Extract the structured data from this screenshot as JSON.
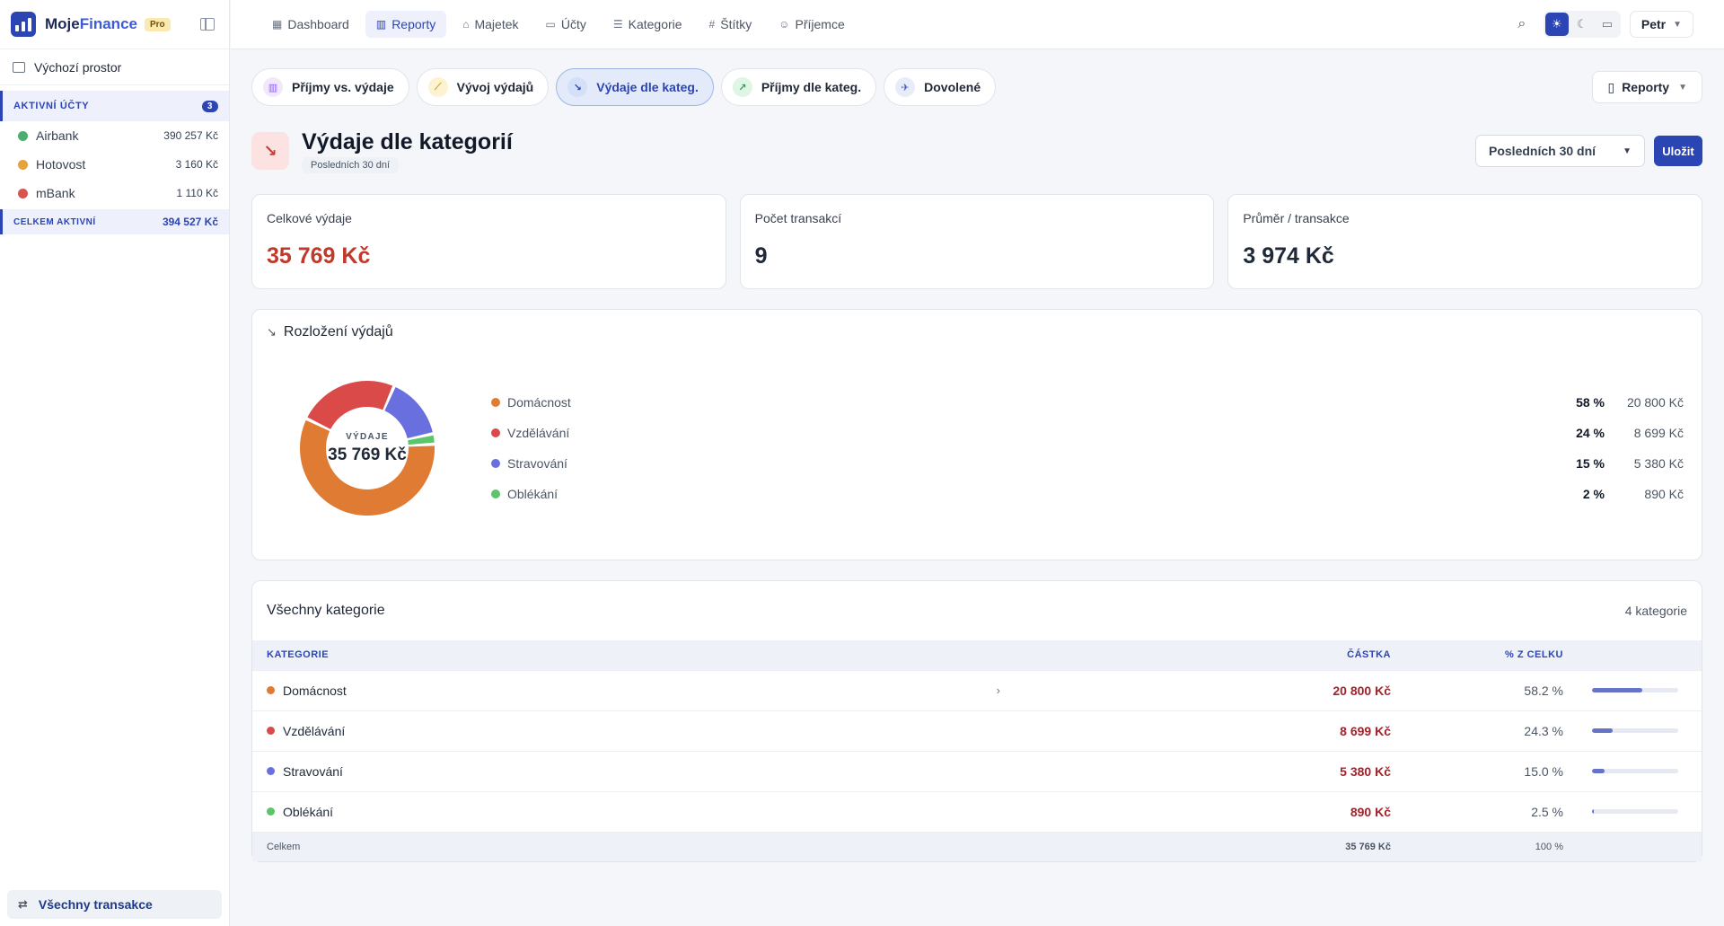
{
  "app": {
    "brand_a": "Moje",
    "brand_b": "Finance",
    "plan": "Pro"
  },
  "workspace": "Výchozí prostor",
  "accounts": {
    "header": "AKTIVNÍ ÚČTY",
    "count": "3",
    "items": [
      {
        "name": "Airbank",
        "balance": "390 257 Kč",
        "color": "#4caf6d"
      },
      {
        "name": "Hotovost",
        "balance": "3 160 Kč",
        "color": "#e6a23c"
      },
      {
        "name": "mBank",
        "balance": "1 110 Kč",
        "color": "#d9534f"
      }
    ],
    "total_label": "CELKEM AKTIVNÍ",
    "total": "394 527 Kč"
  },
  "sidebar_footer": "Všechny transakce",
  "nav": [
    {
      "label": "Dashboard",
      "icon": "grid-icon",
      "active": false
    },
    {
      "label": "Reporty",
      "icon": "bar-chart-icon",
      "active": true
    },
    {
      "label": "Majetek",
      "icon": "bank-icon",
      "active": false
    },
    {
      "label": "Účty",
      "icon": "wallet-icon",
      "active": false
    },
    {
      "label": "Kategorie",
      "icon": "tag-tree-icon",
      "active": false
    },
    {
      "label": "Štítky",
      "icon": "hash-icon",
      "active": false
    },
    {
      "label": "Příjemce",
      "icon": "users-icon",
      "active": false
    }
  ],
  "user": "Petr",
  "report_tabs": [
    {
      "label": "Příjmy vs. výdaje",
      "icon": "bar-chart-icon",
      "bg": "#f1e8fb",
      "fg": "#8b5cf6",
      "active": false
    },
    {
      "label": "Vývoj výdajů",
      "icon": "line-chart-icon",
      "bg": "#fdf3d3",
      "fg": "#c9a227",
      "active": false
    },
    {
      "label": "Výdaje dle kateg.",
      "icon": "trend-down-icon",
      "bg": "#d3e0f8",
      "fg": "#2b45b5",
      "active": true
    },
    {
      "label": "Příjmy dle kateg.",
      "icon": "trend-up-icon",
      "bg": "#dff5e5",
      "fg": "#2e9e5b",
      "active": false
    },
    {
      "label": "Dovolené",
      "icon": "plane-icon",
      "bg": "#e7ecf8",
      "fg": "#4a5db8",
      "active": false
    }
  ],
  "reporty_button": "Reporty",
  "page": {
    "title": "Výdaje dle kategorií",
    "subtitle": "Posledních 30 dní",
    "period": "Posledních 30 dní",
    "save": "Uložit"
  },
  "stats": [
    {
      "label": "Celkové výdaje",
      "value": "35 769 Kč",
      "red": true
    },
    {
      "label": "Počet transakcí",
      "value": "9",
      "red": false
    },
    {
      "label": "Průměr / transakce",
      "value": "3 974 Kč",
      "red": false
    }
  ],
  "chart": {
    "title": "Rozložení výdajů",
    "center_label": "VÝDAJE",
    "center_value": "35 769 Kč"
  },
  "chart_data": {
    "type": "pie",
    "categories": [
      "Domácnost",
      "Vzdělávání",
      "Stravování",
      "Oblékání"
    ],
    "values": [
      20800,
      8699,
      5380,
      890
    ],
    "percent_labels": [
      "58 %",
      "24 %",
      "15 %",
      "2 %"
    ],
    "amount_labels": [
      "20 800 Kč",
      "8 699 Kč",
      "5 380 Kč",
      "890 Kč"
    ],
    "colors": [
      "#e07b34",
      "#d94a48",
      "#6a6fe0",
      "#5cc46a"
    ],
    "title": "Rozložení výdajů"
  },
  "table": {
    "title": "Všechny kategorie",
    "count": "4 kategorie",
    "headers": {
      "category": "KATEGORIE",
      "amount": "ČÁSTKA",
      "percent": "% Z CELKU"
    },
    "rows": [
      {
        "name": "Domácnost",
        "amount": "20 800 Kč",
        "percent": "58.2 %",
        "share": 0.582,
        "color": "#e07b34",
        "expandable": true
      },
      {
        "name": "Vzdělávání",
        "amount": "8 699 Kč",
        "percent": "24.3 %",
        "share": 0.243,
        "color": "#d94a48",
        "expandable": false
      },
      {
        "name": "Stravování",
        "amount": "5 380 Kč",
        "percent": "15.0 %",
        "share": 0.15,
        "color": "#6a6fe0",
        "expandable": false
      },
      {
        "name": "Oblékání",
        "amount": "890 Kč",
        "percent": "2.5 %",
        "share": 0.025,
        "color": "#5cc46a",
        "expandable": false
      }
    ],
    "total": {
      "label": "Celkem",
      "amount": "35 769 Kč",
      "percent": "100 %"
    }
  }
}
